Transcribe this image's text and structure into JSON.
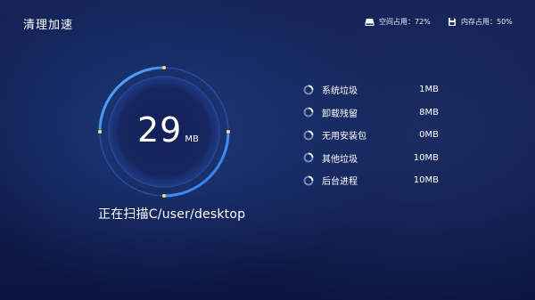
{
  "header": {
    "title": "清理加速",
    "space": {
      "icon": "disk-icon",
      "label": "空间占用：72%"
    },
    "memory": {
      "icon": "memory-card-icon",
      "label": "内存占用：50%"
    }
  },
  "gauge": {
    "value": "29",
    "unit": "MB"
  },
  "scan_status": "正在扫描C/user/desktop",
  "items": [
    {
      "label": "系统垃圾",
      "size": "1MB"
    },
    {
      "label": "卸载残留",
      "size": "8MB"
    },
    {
      "label": "无用安装包",
      "size": "0MB"
    },
    {
      "label": "其他垃圾",
      "size": "10MB"
    },
    {
      "label": "后台进程",
      "size": "10MB"
    }
  ],
  "colors": {
    "accent": "#3a8cff",
    "ring_dot": "#f4e66b"
  }
}
